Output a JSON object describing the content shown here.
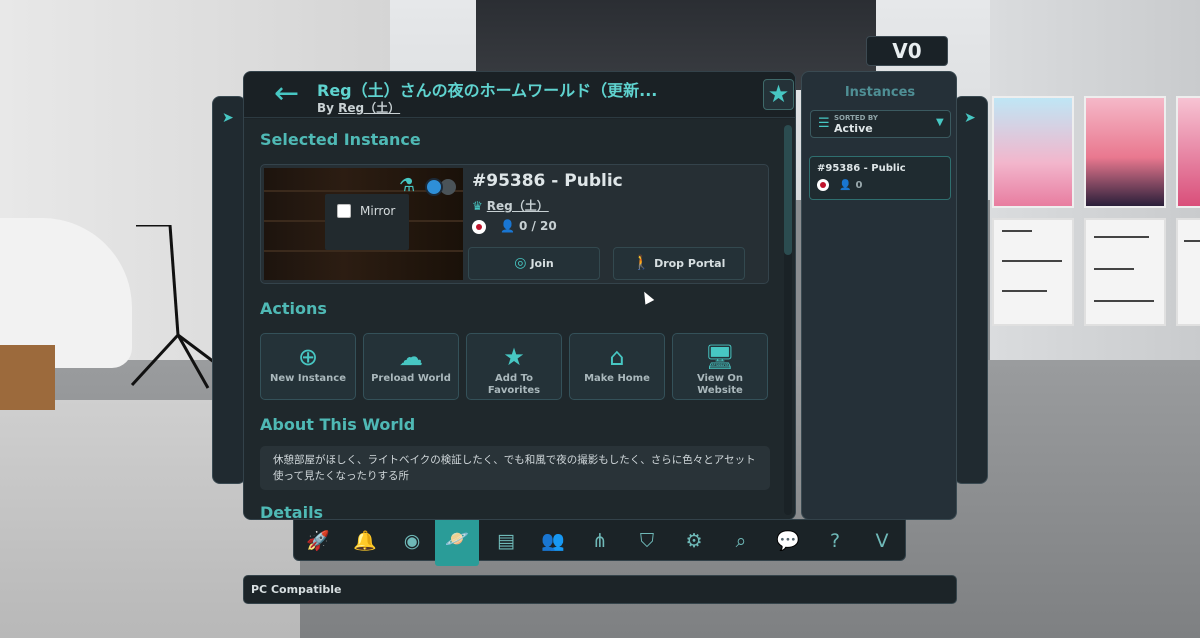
{
  "balance": {
    "currency_symbol": "V",
    "amount": "0"
  },
  "header": {
    "back_label": "←",
    "title": "Reg（土）さんの夜のホームワールド（更新...",
    "by_prefix": "By",
    "author": "Reg（土）",
    "favorite_glyph": "★"
  },
  "selected_instance": {
    "section_title": "Selected Instance",
    "mirror_label": "Mirror",
    "name": "#95386 - Public",
    "owner": "Reg（土）",
    "region_flag": "jp",
    "user_count": "0 / 20",
    "join_label": "Join",
    "drop_portal_label": "Drop Portal"
  },
  "actions": {
    "section_title": "Actions",
    "items": [
      {
        "label": "New Instance",
        "icon": "plus-circle-icon"
      },
      {
        "label": "Preload World",
        "icon": "cloud-download-icon"
      },
      {
        "label": "Add To Favorites",
        "icon": "star-icon"
      },
      {
        "label": "Make Home",
        "icon": "home-icon"
      },
      {
        "label": "View On Website",
        "icon": "monitor-icon"
      }
    ]
  },
  "about": {
    "section_title": "About This World",
    "description": "休憩部屋がほしく、ライトベイクの検証したく、でも和風で夜の撮影もしたく、さらに色々とアセット使って見たくなったりする所"
  },
  "details": {
    "section_title": "Details"
  },
  "instances_panel": {
    "title": "Instances",
    "sort_caption": "SORTED BY",
    "sort_value": "Active",
    "items": [
      {
        "name": "#95386 - Public",
        "region_flag": "jp",
        "user_count": "0"
      }
    ]
  },
  "tabbar": {
    "tabs": [
      {
        "icon": "rocket-icon",
        "active": false
      },
      {
        "icon": "bell-icon",
        "active": false
      },
      {
        "icon": "profile-icon",
        "active": false
      },
      {
        "icon": "planet-icon",
        "active": true
      },
      {
        "icon": "avatar-book-icon",
        "active": false
      },
      {
        "icon": "social-icon",
        "active": false
      },
      {
        "icon": "groups-icon",
        "active": false
      },
      {
        "icon": "safety-shield-icon",
        "active": false
      },
      {
        "icon": "settings-gear-icon",
        "active": false
      },
      {
        "icon": "search-icon",
        "active": false
      },
      {
        "icon": "chat-plus-icon",
        "active": false
      },
      {
        "icon": "help-icon",
        "active": false
      },
      {
        "icon": "vrchat-plus-icon",
        "active": false
      }
    ]
  },
  "platform": {
    "label": "PC Compatible"
  },
  "colors": {
    "accent": "#47c7c3",
    "panel": "#1d2428",
    "active_tab": "#2a9c98"
  }
}
